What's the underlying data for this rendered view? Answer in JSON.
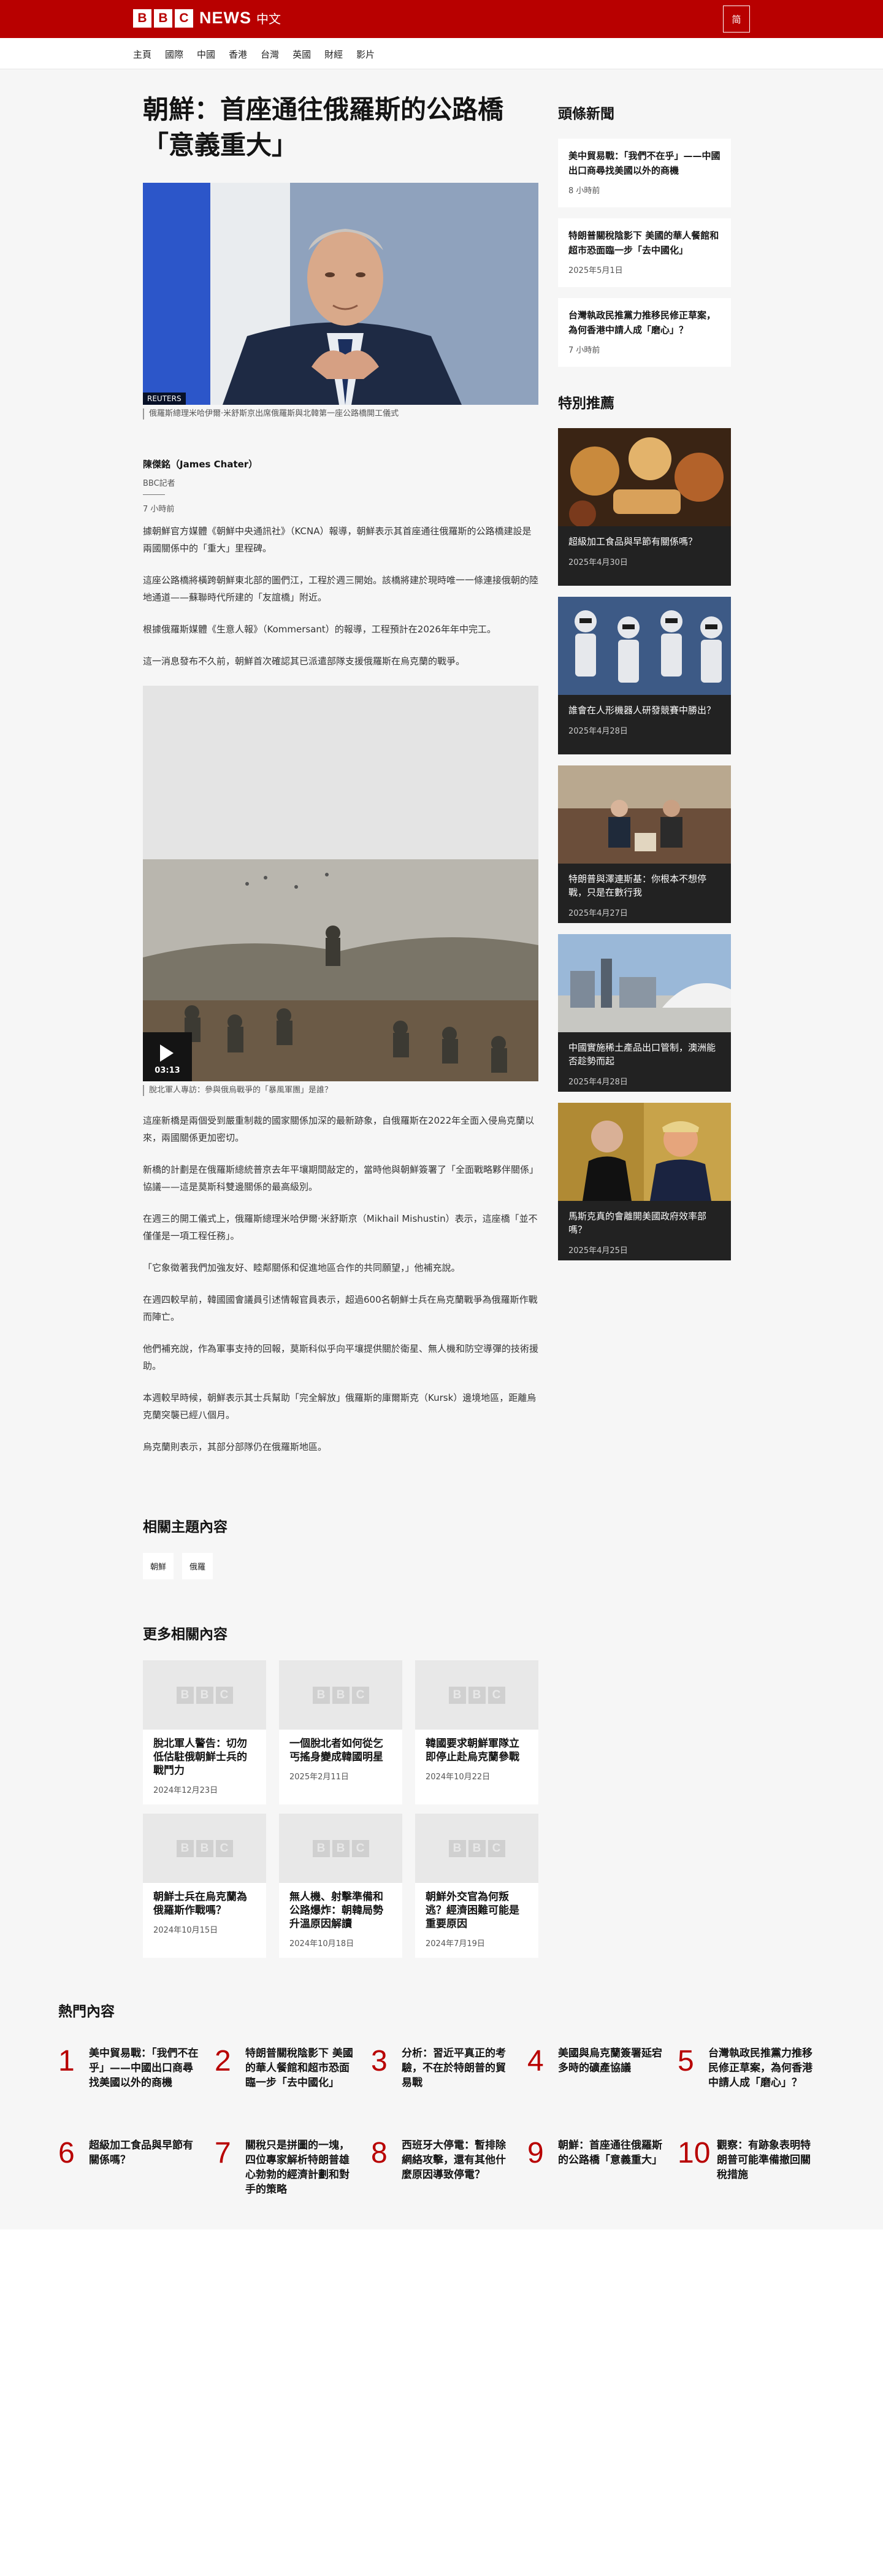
{
  "header": {
    "logo_letters": [
      "B",
      "B",
      "C"
    ],
    "logo_news": "NEWS",
    "logo_zh": "中文",
    "lang_toggle": "简",
    "brand_color": "#b80000"
  },
  "nav": [
    "主頁",
    "國際",
    "中國",
    "香港",
    "台灣",
    "英國",
    "財經",
    "影片"
  ],
  "article": {
    "headline": "朝鮮：首座通往俄羅斯的公路橋「意義重大」",
    "image_credit": "REUTERS",
    "image_caption": "俄羅斯總理米哈伊爾·米舒斯京出席俄羅斯與北韓第一座公路橋開工儀式",
    "author": "陳傑銘（James Chater）",
    "role": "BBC記者",
    "time": "7 小時前",
    "paragraphs_a": [
      "據朝鮮官方媒體《朝鮮中央通訊社》（KCNA）報導，朝鮮表示其首座通往俄羅斯的公路橋建設是兩國關係中的「重大」里程碑。",
      "這座公路橋將橫跨朝鮮東北部的圖們江，工程於週三開始。該橋將建於現時唯一一條連接俄朝的陸地通道——蘇聯時代所建的「友誼橋」附近。",
      "根據俄羅斯媒體《生意人報》（Kommersant）的報導，工程預計在2026年年中完工。",
      "這一消息發布不久前，朝鮮首次確認其已派遣部隊支援俄羅斯在烏克蘭的戰爭。"
    ],
    "video_duration": "03:13",
    "video_caption": "脫北軍人專訪：參與俄烏戰爭的「暴風軍團」是誰？",
    "paragraphs_b": [
      "這座新橋是兩個受到嚴重制裁的國家關係加深的最新跡象，自俄羅斯在2022年全面入侵烏克蘭以來，兩國關係更加密切。",
      "新橋的計劃是在俄羅斯總統普京去年平壤期間敲定的，當時他與朝鮮簽署了「全面戰略夥伴關係」協議——這是莫斯科雙邊關係的最高級別。",
      "在週三的開工儀式上，俄羅斯總理米哈伊爾·米舒斯京（Mikhail Mishustin）表示，這座橋「並不僅僅是一項工程任務」。",
      "「它象徵著我們加強友好、睦鄰關係和促進地區合作的共同願望，」他補充說。",
      "在週四較早前，韓國國會議員引述情報官員表示，超過600名朝鮮士兵在烏克蘭戰爭為俄羅斯作戰而陣亡。",
      "他們補充說，作為軍事支持的回報，莫斯科似乎向平壤提供關於衛星、無人機和防空導彈的技術援助。",
      "本週較早時候，朝鮮表示其士兵幫助「完全解放」俄羅斯的庫爾斯克（Kursk）邊境地區，距離烏克蘭突襲已經八個月。",
      "烏克蘭則表示，其部分部隊仍在俄羅斯地區。"
    ]
  },
  "related": {
    "topics_title": "相關主題內容",
    "tags": [
      "朝鮮",
      "俄羅"
    ],
    "more_title": "更多相關內容",
    "cards": [
      {
        "title": "脫北軍人警告：切勿低估駐俄朝鮮士兵的戰鬥力",
        "date": "2024年12月23日"
      },
      {
        "title": "一個脫北者如何從乞丐搖身變成韓國明星",
        "date": "2025年2月11日"
      },
      {
        "title": "韓國要求朝鮮軍隊立即停止赴烏克蘭參戰",
        "date": "2024年10月22日"
      },
      {
        "title": "朝鮮士兵在烏克蘭為俄羅斯作戰嗎？",
        "date": "2024年10月15日"
      },
      {
        "title": "無人機、射擊準備和公路爆炸：朝韓局勢升溫原因解讀",
        "date": "2024年10月18日"
      },
      {
        "title": "朝鮮外交官為何叛逃？經濟困難可能是重要原因",
        "date": "2024年7月19日"
      }
    ]
  },
  "sidebar": {
    "top_title": "頭條新聞",
    "top_stories": [
      {
        "title": "美中貿易戰：「我們不在乎」——中國出口商尋找美國以外的商機",
        "date": "8 小時前"
      },
      {
        "title": "特朗普關稅陰影下 美國的華人餐館和超市恐面臨一步「去中國化」",
        "date": "2025年5月1日"
      },
      {
        "title": "台灣執政民推黨力推移民修正草案，為何香港中請人成「磨心」？",
        "date": "7 小時前"
      }
    ],
    "featured_title": "特別推薦",
    "featured": [
      {
        "title": "超級加工食品與早節有關係嗎？",
        "date": "2025年4月30日"
      },
      {
        "title": "誰會在人形機器人研發競賽中勝出？",
        "date": "2025年4月28日"
      },
      {
        "title": "特朗普與澤連斯基：你根本不想停戰，只是在數行我",
        "date": "2025年4月27日"
      },
      {
        "title": "中國實施稀土產品出口管制，澳洲能否趁勢而起",
        "date": "2025年4月28日"
      },
      {
        "title": "馬斯克真的會離開美國政府效率部嗎？",
        "date": "2025年4月25日"
      }
    ]
  },
  "mostread": {
    "title": "熱門內容",
    "items": [
      {
        "num": "1",
        "text": "美中貿易戰：「我們不在乎」——中國出口商尋找美國以外的商機"
      },
      {
        "num": "2",
        "text": "特朗普關稅陰影下 美國的華人餐館和超市恐面臨一步「去中國化」"
      },
      {
        "num": "3",
        "text": "分析：習近平真正的考驗，不在於特朗普的貿易戰"
      },
      {
        "num": "4",
        "text": "美國與烏克蘭簽署延宕多時的礦產協議"
      },
      {
        "num": "5",
        "text": "台灣執政民推黨力推移民修正草案，為何香港中請人成「磨心」？"
      },
      {
        "num": "6",
        "text": "超級加工食品與早節有關係嗎？"
      },
      {
        "num": "7",
        "text": "關稅只是拼圖的一塊，四位專家解析特朗普雄心勃勃的經濟計劃和對手的策略"
      },
      {
        "num": "8",
        "text": "西班牙大停電：暫排除網絡攻擊，還有其他什麼原因導致停電？"
      },
      {
        "num": "9",
        "text": "朝鮮：首座通往俄羅斯的公路橋「意義重大」"
      },
      {
        "num": "10",
        "text": "觀察：有跡象表明特朗普可能準備撤回關稅措施"
      }
    ]
  }
}
